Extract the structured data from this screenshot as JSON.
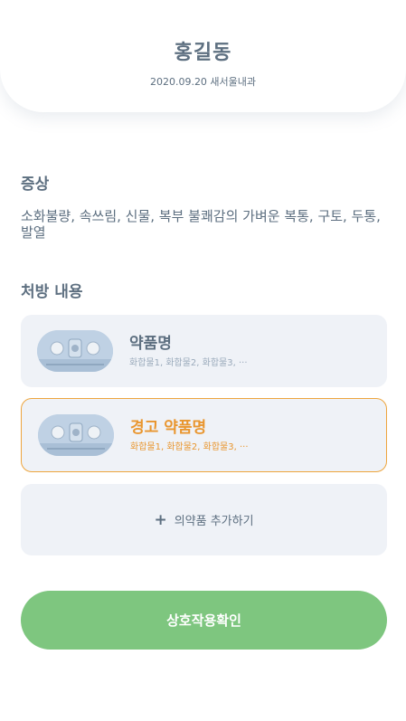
{
  "header": {
    "patient_name": "홍길동",
    "visit_info": "2020.09.20 새서울내과"
  },
  "symptoms": {
    "title": "증상",
    "text": "소화불량, 속쓰림, 신물, 복부 불쾌감의 가벼운 복통, 구토, 두통, 발열"
  },
  "prescription": {
    "title": "처방 내용",
    "drugs": [
      {
        "name": "약품명",
        "ingredients": "화합물1, 화합물2, 화합물3, ···",
        "warning": false
      },
      {
        "name": "경고 약품명",
        "ingredients": "화합물1, 화합물2, 화합물3, ···",
        "warning": true
      }
    ],
    "add_icon": "+",
    "add_label": "의약품 추가하기"
  },
  "actions": {
    "check_label": "상호작용확인"
  },
  "colors": {
    "text": "#5d6f80",
    "card_bg": "#eff2f7",
    "warning": "#e9962f",
    "primary_button": "#7ec67f"
  },
  "icons": {
    "pill_image": "pill-blister-image",
    "add": "plus-icon"
  }
}
